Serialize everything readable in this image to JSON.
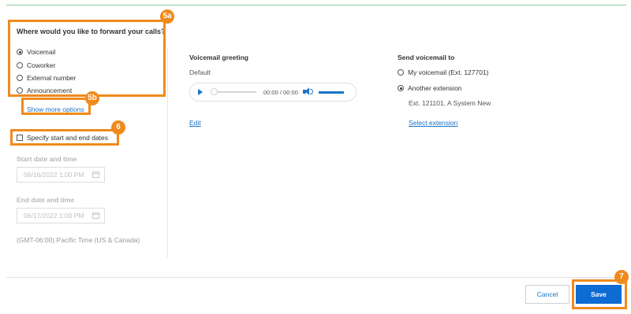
{
  "forward": {
    "question": "Where would you like to forward your calls?",
    "options": [
      {
        "label": "Voicemail",
        "selected": true
      },
      {
        "label": "Coworker",
        "selected": false
      },
      {
        "label": "External number",
        "selected": false
      },
      {
        "label": "Announcement",
        "selected": false
      }
    ],
    "show_more": "Show more options"
  },
  "dates": {
    "checkbox_label": "Specify start and end dates",
    "start_label": "Start date and time",
    "start_value": "06/16/2022 1:00 PM",
    "end_label": "End date and time",
    "end_value": "06/17/2022 1:00 PM",
    "timezone": "(GMT-06:00) Pacific Time (US & Canada)"
  },
  "greeting": {
    "title": "Voicemail greeting",
    "value": "Default",
    "player_time": "00:00 / 00:00",
    "edit": "Edit"
  },
  "send_to": {
    "title": "Send voicemail to",
    "options": [
      {
        "label": "My voicemail (Ext. 127701)",
        "selected": false
      },
      {
        "label": "Another extension",
        "selected": true
      }
    ],
    "extension_info": "Ext. 121101, A System New",
    "select_link": "Select extension"
  },
  "actions": {
    "cancel": "Cancel",
    "save": "Save"
  },
  "callouts": {
    "c5a": "5a",
    "c5b": "5b",
    "c6": "6",
    "c7": "7"
  },
  "colors": {
    "callout": "#f08a1c",
    "accent": "#0d6bd3",
    "link": "#1a73c8"
  }
}
